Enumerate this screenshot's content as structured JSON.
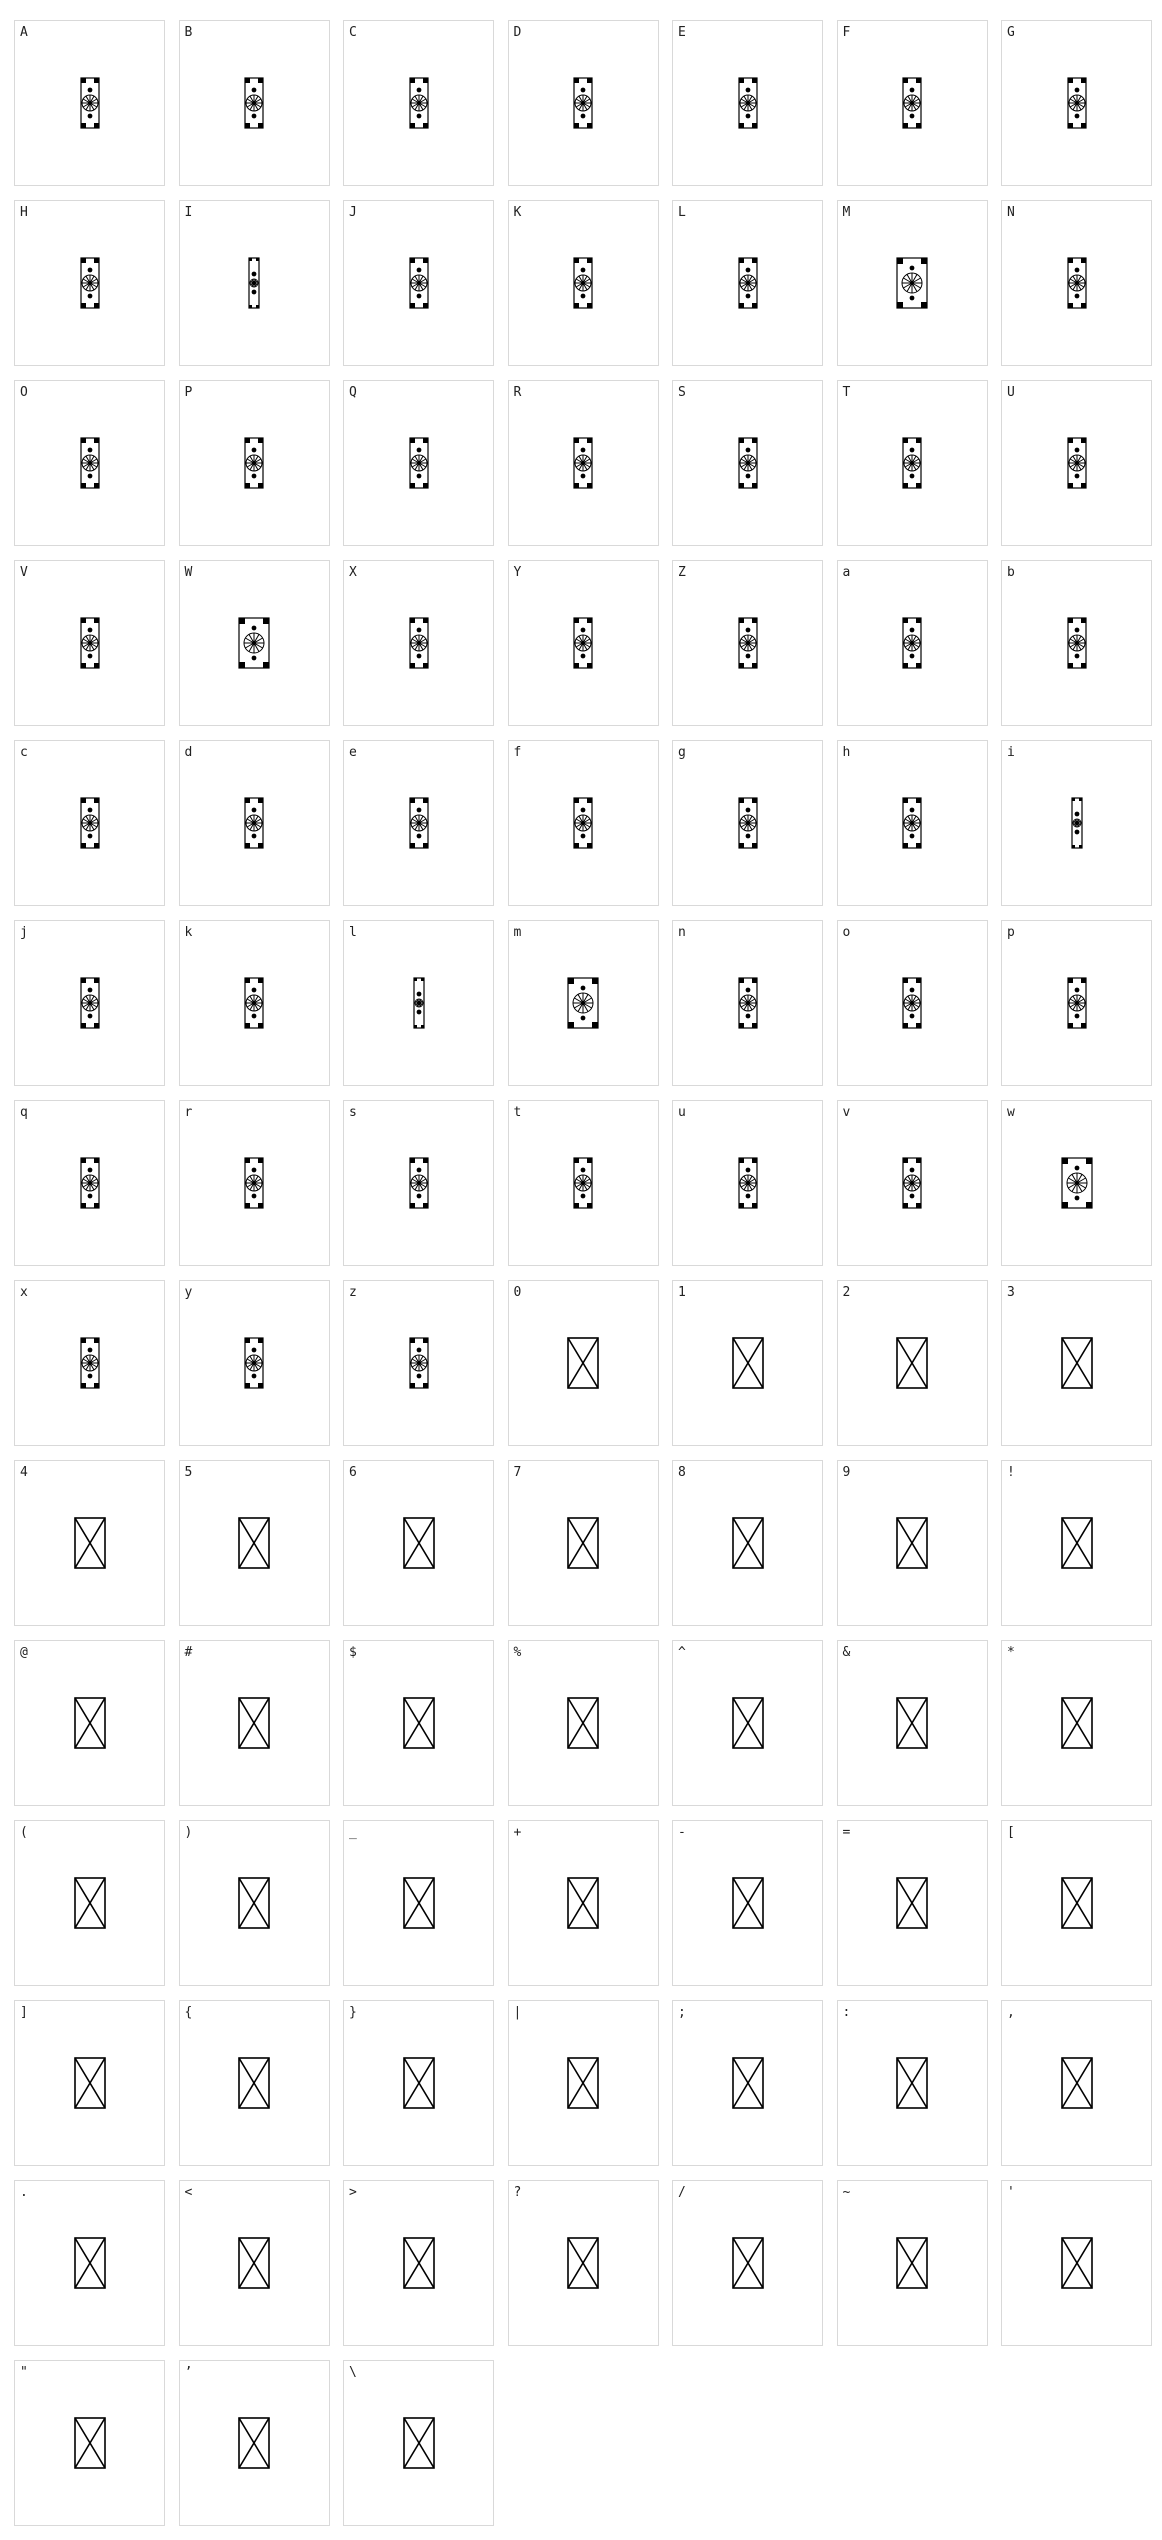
{
  "chart_data": {
    "type": "table",
    "cells": [
      {
        "char": "A",
        "rendered": true,
        "icon": "ornamental-glyph-icon"
      },
      {
        "char": "B",
        "rendered": true,
        "icon": "ornamental-glyph-icon"
      },
      {
        "char": "C",
        "rendered": true,
        "icon": "ornamental-glyph-icon"
      },
      {
        "char": "D",
        "rendered": true,
        "icon": "ornamental-glyph-icon"
      },
      {
        "char": "E",
        "rendered": true,
        "icon": "ornamental-glyph-icon"
      },
      {
        "char": "F",
        "rendered": true,
        "icon": "ornamental-glyph-icon"
      },
      {
        "char": "G",
        "rendered": true,
        "icon": "ornamental-glyph-icon"
      },
      {
        "char": "H",
        "rendered": true,
        "icon": "ornamental-glyph-icon"
      },
      {
        "char": "I",
        "rendered": true,
        "icon": "ornamental-glyph-icon"
      },
      {
        "char": "J",
        "rendered": true,
        "icon": "ornamental-glyph-icon"
      },
      {
        "char": "K",
        "rendered": true,
        "icon": "ornamental-glyph-icon"
      },
      {
        "char": "L",
        "rendered": true,
        "icon": "ornamental-glyph-icon"
      },
      {
        "char": "M",
        "rendered": true,
        "icon": "ornamental-glyph-icon"
      },
      {
        "char": "N",
        "rendered": true,
        "icon": "ornamental-glyph-icon"
      },
      {
        "char": "O",
        "rendered": true,
        "icon": "ornamental-glyph-icon"
      },
      {
        "char": "P",
        "rendered": true,
        "icon": "ornamental-glyph-icon"
      },
      {
        "char": "Q",
        "rendered": true,
        "icon": "ornamental-glyph-icon"
      },
      {
        "char": "R",
        "rendered": true,
        "icon": "ornamental-glyph-icon"
      },
      {
        "char": "S",
        "rendered": true,
        "icon": "ornamental-glyph-icon"
      },
      {
        "char": "T",
        "rendered": true,
        "icon": "ornamental-glyph-icon"
      },
      {
        "char": "U",
        "rendered": true,
        "icon": "ornamental-glyph-icon"
      },
      {
        "char": "V",
        "rendered": true,
        "icon": "ornamental-glyph-icon"
      },
      {
        "char": "W",
        "rendered": true,
        "icon": "ornamental-glyph-icon"
      },
      {
        "char": "X",
        "rendered": true,
        "icon": "ornamental-glyph-icon"
      },
      {
        "char": "Y",
        "rendered": true,
        "icon": "ornamental-glyph-icon"
      },
      {
        "char": "Z",
        "rendered": true,
        "icon": "ornamental-glyph-icon"
      },
      {
        "char": "a",
        "rendered": true,
        "icon": "ornamental-glyph-icon"
      },
      {
        "char": "b",
        "rendered": true,
        "icon": "ornamental-glyph-icon"
      },
      {
        "char": "c",
        "rendered": true,
        "icon": "ornamental-glyph-icon"
      },
      {
        "char": "d",
        "rendered": true,
        "icon": "ornamental-glyph-icon"
      },
      {
        "char": "e",
        "rendered": true,
        "icon": "ornamental-glyph-icon"
      },
      {
        "char": "f",
        "rendered": true,
        "icon": "ornamental-glyph-icon"
      },
      {
        "char": "g",
        "rendered": true,
        "icon": "ornamental-glyph-icon"
      },
      {
        "char": "h",
        "rendered": true,
        "icon": "ornamental-glyph-icon"
      },
      {
        "char": "i",
        "rendered": true,
        "icon": "ornamental-glyph-icon"
      },
      {
        "char": "j",
        "rendered": true,
        "icon": "ornamental-glyph-icon"
      },
      {
        "char": "k",
        "rendered": true,
        "icon": "ornamental-glyph-icon"
      },
      {
        "char": "l",
        "rendered": true,
        "icon": "ornamental-glyph-icon"
      },
      {
        "char": "m",
        "rendered": true,
        "icon": "ornamental-glyph-icon"
      },
      {
        "char": "n",
        "rendered": true,
        "icon": "ornamental-glyph-icon"
      },
      {
        "char": "o",
        "rendered": true,
        "icon": "ornamental-glyph-icon"
      },
      {
        "char": "p",
        "rendered": true,
        "icon": "ornamental-glyph-icon"
      },
      {
        "char": "q",
        "rendered": true,
        "icon": "ornamental-glyph-icon"
      },
      {
        "char": "r",
        "rendered": true,
        "icon": "ornamental-glyph-icon"
      },
      {
        "char": "s",
        "rendered": true,
        "icon": "ornamental-glyph-icon"
      },
      {
        "char": "t",
        "rendered": true,
        "icon": "ornamental-glyph-icon"
      },
      {
        "char": "u",
        "rendered": true,
        "icon": "ornamental-glyph-icon"
      },
      {
        "char": "v",
        "rendered": true,
        "icon": "ornamental-glyph-icon"
      },
      {
        "char": "w",
        "rendered": true,
        "icon": "ornamental-glyph-icon"
      },
      {
        "char": "x",
        "rendered": true,
        "icon": "ornamental-glyph-icon"
      },
      {
        "char": "y",
        "rendered": true,
        "icon": "ornamental-glyph-icon"
      },
      {
        "char": "z",
        "rendered": true,
        "icon": "ornamental-glyph-icon"
      },
      {
        "char": "0",
        "rendered": false,
        "icon": "missing-glyph-icon"
      },
      {
        "char": "1",
        "rendered": false,
        "icon": "missing-glyph-icon"
      },
      {
        "char": "2",
        "rendered": false,
        "icon": "missing-glyph-icon"
      },
      {
        "char": "3",
        "rendered": false,
        "icon": "missing-glyph-icon"
      },
      {
        "char": "4",
        "rendered": false,
        "icon": "missing-glyph-icon"
      },
      {
        "char": "5",
        "rendered": false,
        "icon": "missing-glyph-icon"
      },
      {
        "char": "6",
        "rendered": false,
        "icon": "missing-glyph-icon"
      },
      {
        "char": "7",
        "rendered": false,
        "icon": "missing-glyph-icon"
      },
      {
        "char": "8",
        "rendered": false,
        "icon": "missing-glyph-icon"
      },
      {
        "char": "9",
        "rendered": false,
        "icon": "missing-glyph-icon"
      },
      {
        "char": "!",
        "rendered": false,
        "icon": "missing-glyph-icon"
      },
      {
        "char": "@",
        "rendered": false,
        "icon": "missing-glyph-icon"
      },
      {
        "char": "#",
        "rendered": false,
        "icon": "missing-glyph-icon"
      },
      {
        "char": "$",
        "rendered": false,
        "icon": "missing-glyph-icon"
      },
      {
        "char": "%",
        "rendered": false,
        "icon": "missing-glyph-icon"
      },
      {
        "char": "^",
        "rendered": false,
        "icon": "missing-glyph-icon"
      },
      {
        "char": "&",
        "rendered": false,
        "icon": "missing-glyph-icon"
      },
      {
        "char": "*",
        "rendered": false,
        "icon": "missing-glyph-icon"
      },
      {
        "char": "(",
        "rendered": false,
        "icon": "missing-glyph-icon"
      },
      {
        "char": ")",
        "rendered": false,
        "icon": "missing-glyph-icon"
      },
      {
        "char": "_",
        "rendered": false,
        "icon": "missing-glyph-icon"
      },
      {
        "char": "+",
        "rendered": false,
        "icon": "missing-glyph-icon"
      },
      {
        "char": "-",
        "rendered": false,
        "icon": "missing-glyph-icon"
      },
      {
        "char": "=",
        "rendered": false,
        "icon": "missing-glyph-icon"
      },
      {
        "char": "[",
        "rendered": false,
        "icon": "missing-glyph-icon"
      },
      {
        "char": "]",
        "rendered": false,
        "icon": "missing-glyph-icon"
      },
      {
        "char": "{",
        "rendered": false,
        "icon": "missing-glyph-icon"
      },
      {
        "char": "}",
        "rendered": false,
        "icon": "missing-glyph-icon"
      },
      {
        "char": "|",
        "rendered": false,
        "icon": "missing-glyph-icon"
      },
      {
        "char": ";",
        "rendered": false,
        "icon": "missing-glyph-icon"
      },
      {
        "char": ":",
        "rendered": false,
        "icon": "missing-glyph-icon"
      },
      {
        "char": ",",
        "rendered": false,
        "icon": "missing-glyph-icon"
      },
      {
        "char": ".",
        "rendered": false,
        "icon": "missing-glyph-icon"
      },
      {
        "char": "<",
        "rendered": false,
        "icon": "missing-glyph-icon"
      },
      {
        "char": ">",
        "rendered": false,
        "icon": "missing-glyph-icon"
      },
      {
        "char": "?",
        "rendered": false,
        "icon": "missing-glyph-icon"
      },
      {
        "char": "/",
        "rendered": false,
        "icon": "missing-glyph-icon"
      },
      {
        "char": "~",
        "rendered": false,
        "icon": "missing-glyph-icon"
      },
      {
        "char": "'",
        "rendered": false,
        "icon": "missing-glyph-icon"
      },
      {
        "char": "\"",
        "rendered": false,
        "icon": "missing-glyph-icon"
      },
      {
        "char": "’",
        "rendered": false,
        "icon": "missing-glyph-icon"
      },
      {
        "char": "\\",
        "rendered": false,
        "icon": "missing-glyph-icon"
      }
    ]
  },
  "colors": {
    "cell_border": "#d9d9d9",
    "label_text": "#222222",
    "glyph": "#000000",
    "background": "#ffffff"
  }
}
